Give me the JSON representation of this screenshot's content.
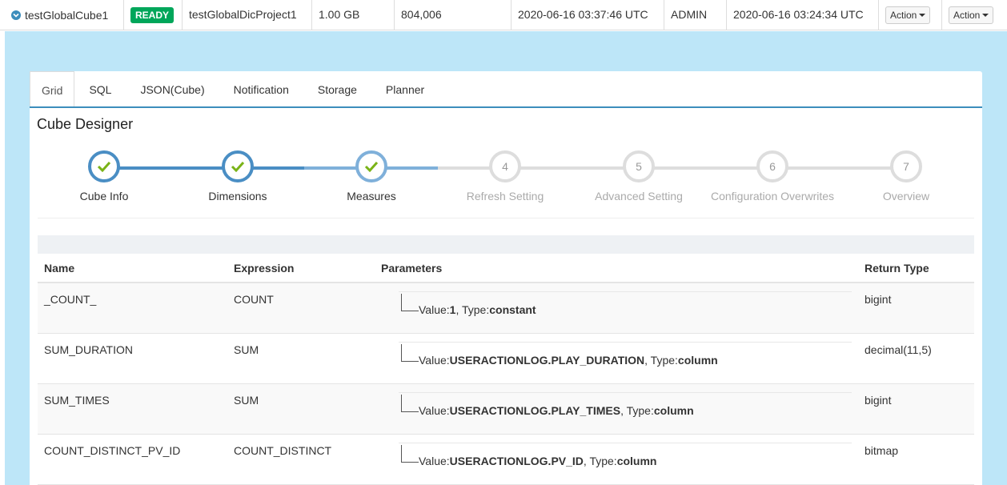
{
  "cube_row": {
    "name": "testGlobalCube1",
    "status": "READY",
    "project": "testGlobalDicProject1",
    "size": "1.00 GB",
    "records": "804,006",
    "last_build": "2020-06-16 03:37:46 UTC",
    "owner": "ADMIN",
    "create_time": "2020-06-16 03:24:34 UTC",
    "action1": "Action",
    "action2": "Action"
  },
  "tabs": [
    "Grid",
    "SQL",
    "JSON(Cube)",
    "Notification",
    "Storage",
    "Planner"
  ],
  "designer": {
    "title": "Cube Designer"
  },
  "steps": [
    {
      "number": "1",
      "label": "Cube Info",
      "state": "done"
    },
    {
      "number": "2",
      "label": "Dimensions",
      "state": "done"
    },
    {
      "number": "3",
      "label": "Measures",
      "state": "current"
    },
    {
      "number": "4",
      "label": "Refresh Setting",
      "state": "todo"
    },
    {
      "number": "5",
      "label": "Advanced Setting",
      "state": "todo"
    },
    {
      "number": "6",
      "label": "Configuration Overwrites",
      "state": "todo"
    },
    {
      "number": "7",
      "label": "Overview",
      "state": "todo"
    }
  ],
  "measures": {
    "headers": {
      "name": "Name",
      "expression": "Expression",
      "parameters": "Parameters",
      "return_type": "Return Type"
    },
    "value_label": "Value:",
    "type_label": ", Type:",
    "rows": [
      {
        "name": "_COUNT_",
        "expression": "COUNT",
        "value": "1",
        "type": "constant",
        "return_type": "bigint"
      },
      {
        "name": "SUM_DURATION",
        "expression": "SUM",
        "value": "USERACTIONLOG.PLAY_DURATION",
        "type": "column",
        "return_type": "decimal(11,5)"
      },
      {
        "name": "SUM_TIMES",
        "expression": "SUM",
        "value": "USERACTIONLOG.PLAY_TIMES",
        "type": "column",
        "return_type": "bigint"
      },
      {
        "name": "COUNT_DISTINCT_PV_ID",
        "expression": "COUNT_DISTINCT",
        "value": "USERACTIONLOG.PV_ID",
        "type": "column",
        "return_type": "bitmap"
      }
    ]
  },
  "colors": {
    "accent": "#3c8dbc",
    "ready": "#00a65a",
    "background": "#bde6f8",
    "check": "#7ab317"
  }
}
